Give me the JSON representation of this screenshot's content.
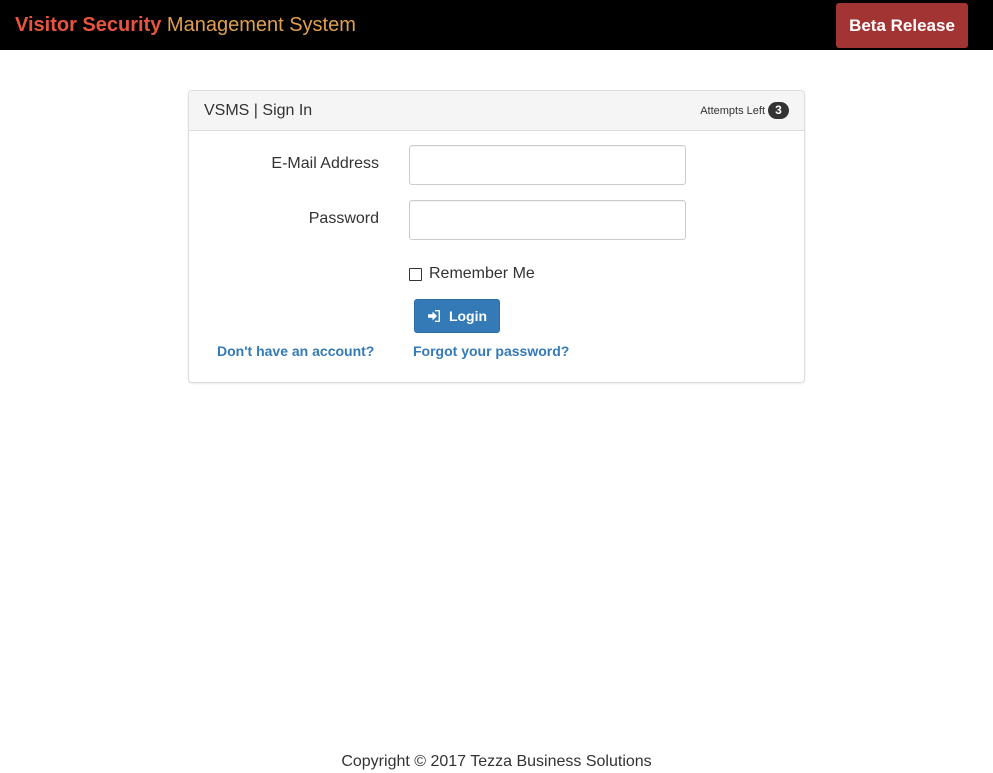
{
  "navbar": {
    "brand_strong": "Visitor Security",
    "brand_light": "Management System",
    "beta_button": "Beta Release"
  },
  "panel": {
    "title": "VSMS | Sign In",
    "attempts_label": "Attempts Left",
    "attempts_count": "3"
  },
  "form": {
    "email_label": "E-Mail Address",
    "email_value": "",
    "password_label": "Password",
    "password_value": "",
    "remember_label": "Remember Me",
    "remember_checked": false,
    "login_button": "Login",
    "login_icon": "sign-in-icon",
    "register_link": "Don't have an account?",
    "forgot_link": "Forgot your password?"
  },
  "footer": {
    "copyright": "Copyright © 2017 Tezza Business Solutions"
  },
  "colors": {
    "navbar_bg": "#000000",
    "brand_strong": "#e8543f",
    "brand_light": "#e0a050",
    "beta_button": "#a33434",
    "primary": "#337ab7"
  }
}
